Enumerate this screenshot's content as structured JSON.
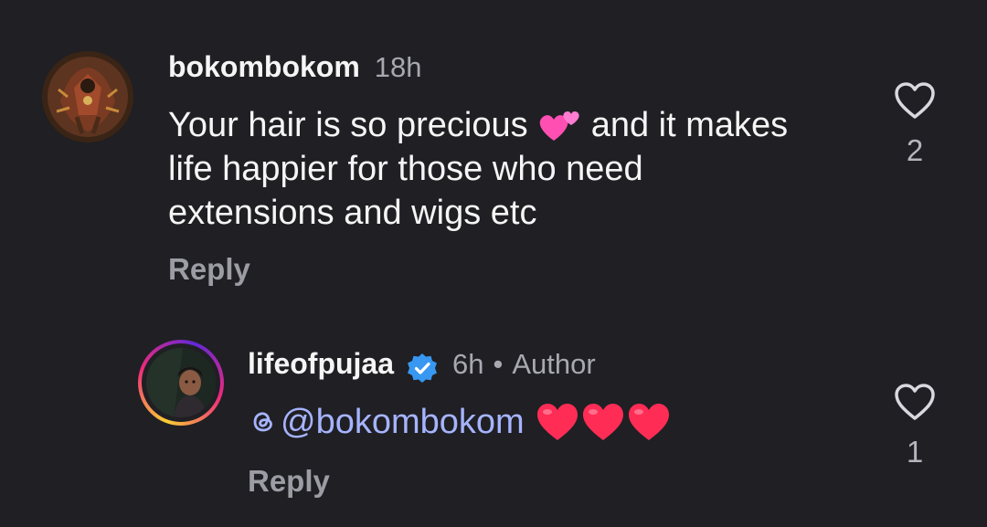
{
  "comments": [
    {
      "username": "bokombokom",
      "time": "18h",
      "text": "Your hair is so precious",
      "text_after_emoji": " and it makes life happier for those who need extensions and wigs etc",
      "emoji": "two-hearts",
      "reply_label": "Reply",
      "like_icon": "heart-outline-icon",
      "like_count": "2"
    },
    {
      "username": "lifeofpujaa",
      "verified": true,
      "time": "6h",
      "separator": "•",
      "role": "Author",
      "mention": "@bokombokom",
      "emoji": "red-heart x3",
      "reply_label": "Reply",
      "like_icon": "heart-outline-icon",
      "like_count": "1"
    }
  ],
  "colors": {
    "background": "#1f1f24",
    "mention": "#a6b4ff",
    "verified": "#3897f0",
    "secondary_text": "#a8a8b0"
  }
}
